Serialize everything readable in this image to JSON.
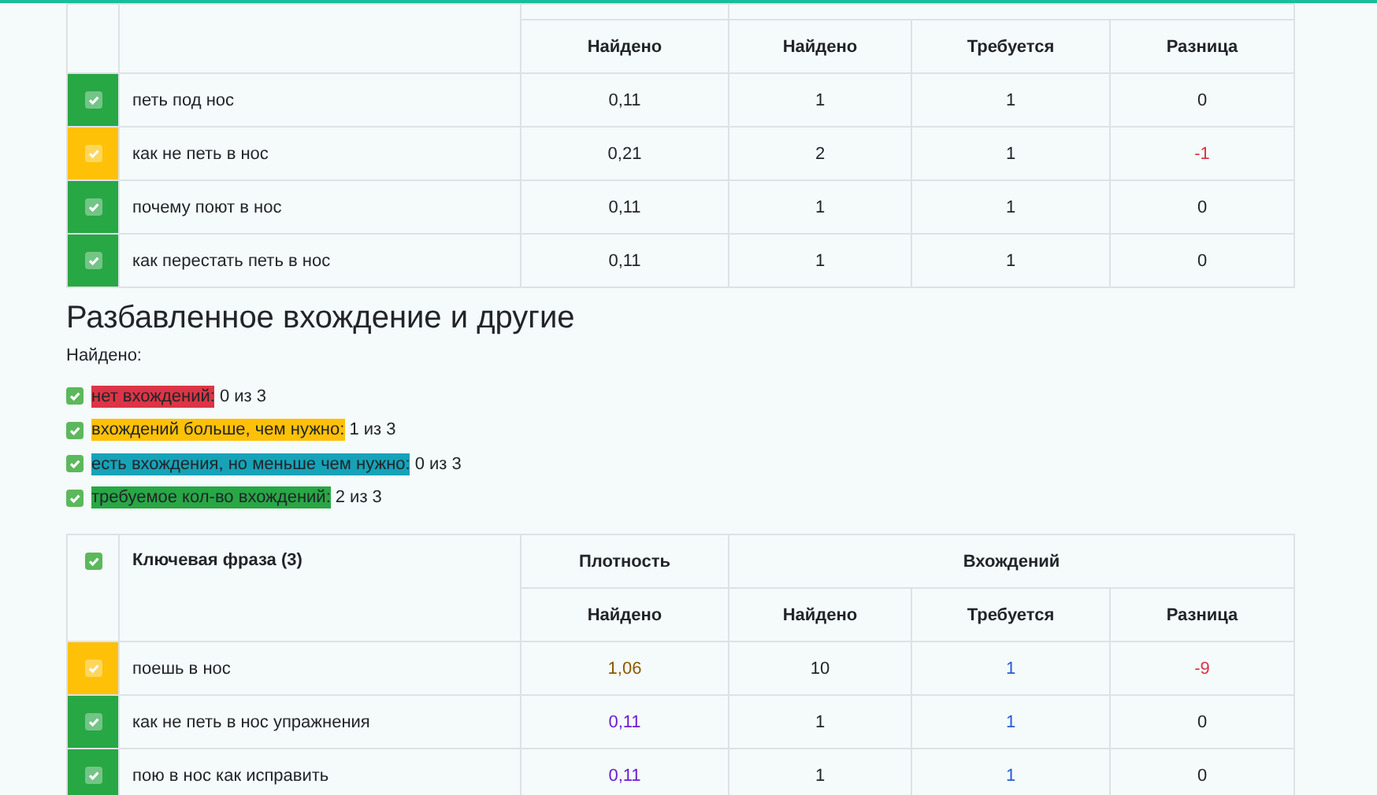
{
  "table_top": {
    "columns": [
      "Найдено",
      "Найдено",
      "Требуется",
      "Разница"
    ],
    "rows": [
      {
        "color": "#28a745",
        "checked": true,
        "phrase": "петь под нос",
        "cells": [
          {
            "text": "0,11"
          },
          {
            "text": "1"
          },
          {
            "text": "1"
          },
          {
            "text": "0"
          }
        ]
      },
      {
        "color": "#ffc107",
        "checked": true,
        "phrase": "как не петь в нос",
        "cells": [
          {
            "text": "0,21"
          },
          {
            "text": "2"
          },
          {
            "text": "1"
          },
          {
            "text": "-1",
            "color": "#dc3545"
          }
        ]
      },
      {
        "color": "#28a745",
        "checked": true,
        "phrase": "почему поют в нос",
        "cells": [
          {
            "text": "0,11"
          },
          {
            "text": "1"
          },
          {
            "text": "1"
          },
          {
            "text": "0"
          }
        ]
      },
      {
        "color": "#28a745",
        "checked": true,
        "phrase": "как перестать петь в нос",
        "cells": [
          {
            "text": "0,11"
          },
          {
            "text": "1"
          },
          {
            "text": "1"
          },
          {
            "text": "0"
          }
        ]
      }
    ]
  },
  "section": {
    "title": "Разбавленное вхождение и другие",
    "found_label": "Найдено:",
    "legend": [
      {
        "checked": true,
        "label": "нет вхождений:",
        "color": "#dc3545",
        "count": "0 из 3"
      },
      {
        "checked": true,
        "label": "вхождений больше, чем нужно:",
        "color": "#ffc107",
        "count": "1 из 3"
      },
      {
        "checked": true,
        "label": "есть вхождения, но меньше чем нужно:",
        "color": "#17a2b8",
        "count": "0 из 3"
      },
      {
        "checked": true,
        "label": "требуемое кол-во вхождений:",
        "color": "#28a745",
        "count": "2 из 3"
      }
    ]
  },
  "table_bottom": {
    "header_checked": true,
    "phrase_header": "Ключевая фраза (3)",
    "density_header": "Плотность",
    "occurrences_header": "Вхождений",
    "columns": [
      "Найдено",
      "Найдено",
      "Требуется",
      "Разница"
    ],
    "rows": [
      {
        "color": "#ffc107",
        "checked": true,
        "phrase": "поешь в нос",
        "cells": [
          {
            "text": "1,06",
            "color": "#8a5a00"
          },
          {
            "text": "10"
          },
          {
            "text": "1",
            "color": "#2a5bd7"
          },
          {
            "text": "-9",
            "color": "#dc3545"
          }
        ]
      },
      {
        "color": "#28a745",
        "checked": true,
        "phrase": "как не петь в нос упражнения",
        "cells": [
          {
            "text": "0,11",
            "color": "#6a1fd1"
          },
          {
            "text": "1"
          },
          {
            "text": "1",
            "color": "#2a5bd7"
          },
          {
            "text": "0"
          }
        ]
      },
      {
        "color": "#28a745",
        "checked": true,
        "phrase": "пою в нос как исправить",
        "cells": [
          {
            "text": "0,11",
            "color": "#6a1fd1"
          },
          {
            "text": "1"
          },
          {
            "text": "1",
            "color": "#2a5bd7"
          },
          {
            "text": "0"
          }
        ]
      }
    ]
  }
}
